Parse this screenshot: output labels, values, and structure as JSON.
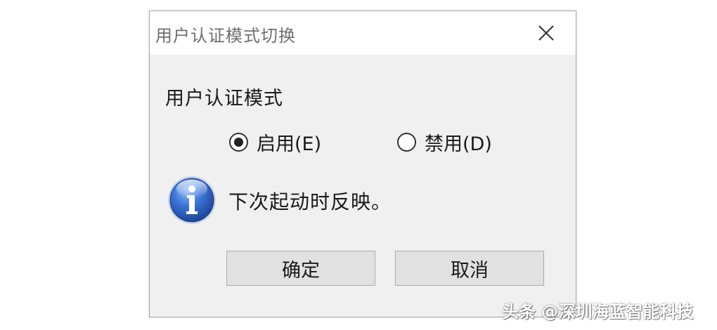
{
  "dialog": {
    "title": "用户认证模式切换",
    "group_label": "用户认证模式",
    "options": [
      {
        "label": "启用(E)",
        "checked": true
      },
      {
        "label": "禁用(D)",
        "checked": false
      }
    ],
    "info_icon": "info-icon",
    "info_text": "下次起动时反映。",
    "ok_label": "确定",
    "cancel_label": "取消",
    "close_icon": "close-icon"
  },
  "watermark": "头条 @深圳海蓝智能科技",
  "colors": {
    "dialog_bg": "#f0f0f0",
    "titlebar_bg": "#ffffff",
    "button_bg": "#e1e1e1",
    "button_border": "#adadad",
    "info_blue": "#2b5fb8"
  }
}
